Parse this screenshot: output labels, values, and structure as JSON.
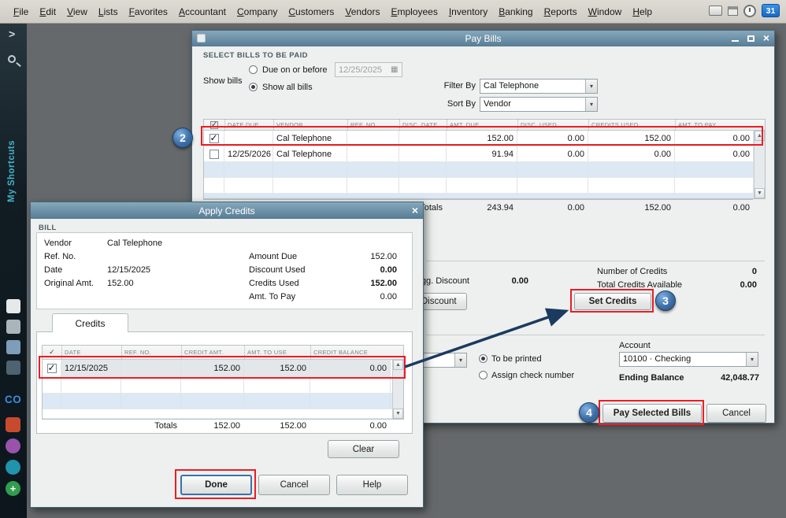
{
  "menu": {
    "items": [
      "File",
      "Edit",
      "View",
      "Lists",
      "Favorites",
      "Accountant",
      "Company",
      "Customers",
      "Vendors",
      "Employees",
      "Inventory",
      "Banking",
      "Reports",
      "Window",
      "Help"
    ],
    "reminder_badge": "31"
  },
  "sidebar": {
    "my_shortcuts": "My Shortcuts",
    "co": "CO"
  },
  "pay_bills": {
    "title": "Pay Bills",
    "select_section": "SELECT BILLS TO BE PAID",
    "show_bills": "Show bills",
    "due_on_or_before": "Due on or before",
    "due_date": "12/25/2025",
    "show_all_bills": "Show all bills",
    "filter_by": "Filter By",
    "filter_value": "Cal Telephone",
    "sort_by": "Sort By",
    "sort_value": "Vendor",
    "columns": {
      "date_due": "DATE DUE",
      "vendor": "VENDOR",
      "ref_no": "REF. NO.",
      "disc_date": "DISC. DATE",
      "amt_due": "AMT. DUE",
      "disc_used": "DISC. USED",
      "credits_used": "CREDITS USED",
      "amt_to_pay": "AMT. TO PAY"
    },
    "rows": [
      {
        "date_due": "",
        "vendor": "Cal Telephone",
        "amt_due": "152.00",
        "disc_used": "0.00",
        "credits_used": "152.00",
        "amt_to_pay": "0.00"
      },
      {
        "date_due": "12/25/2026",
        "vendor": "Cal Telephone",
        "amt_due": "91.94",
        "disc_used": "0.00",
        "credits_used": "0.00",
        "amt_to_pay": "0.00"
      }
    ],
    "totals_label": "Totals",
    "totals": {
      "amt_due": "243.94",
      "disc_used": "0.00",
      "credits_used": "152.00",
      "amt_to_pay": "0.00"
    },
    "sugg_discount_label": "Sugg. Discount",
    "sugg_discount_value": "0.00",
    "set_discount_btn": "Set Discount",
    "set_credits_btn": "Set Credits",
    "number_of_credits_label": "Number of Credits",
    "number_of_credits_value": "0",
    "total_credits_label": "Total Credits Available",
    "total_credits_value": "0.00",
    "to_be_printed": "To be printed",
    "assign_check_number": "Assign check number",
    "account_label": "Account",
    "account_value": "10100 · Checking",
    "ending_balance_label": "Ending Balance",
    "ending_balance_value": "42,048.77",
    "pay_selected_btn": "Pay Selected Bills",
    "cancel_btn": "Cancel"
  },
  "apply_credits": {
    "title": "Apply Credits",
    "bill_section": "BILL",
    "vendor_label": "Vendor",
    "vendor_value": "Cal Telephone",
    "ref_no_label": "Ref. No.",
    "date_label": "Date",
    "date_value": "12/15/2025",
    "original_amt_label": "Original Amt.",
    "original_amt_value": "152.00",
    "amount_due_label": "Amount Due",
    "amount_due_value": "152.00",
    "discount_used_label": "Discount Used",
    "discount_used_value": "0.00",
    "credits_used_label": "Credits Used",
    "credits_used_value": "152.00",
    "amt_to_pay_label": "Amt. To Pay",
    "amt_to_pay_value": "0.00",
    "credits_tab": "Credits",
    "columns": {
      "date": "DATE",
      "ref_no": "REF. NO.",
      "credit_amt": "CREDIT AMT.",
      "amt_to_use": "AMT. TO USE",
      "credit_balance": "CREDIT BALANCE"
    },
    "rows": [
      {
        "date": "12/15/2025",
        "credit_amt": "152.00",
        "amt_to_use": "152.00",
        "credit_balance": "0.00"
      }
    ],
    "totals_label": "Totals",
    "totals": {
      "credit_amt": "152.00",
      "amt_to_use": "152.00",
      "credit_balance": "0.00"
    },
    "clear_btn": "Clear",
    "done_btn": "Done",
    "cancel_btn": "Cancel",
    "help_btn": "Help"
  },
  "annotations": {
    "step2": "2",
    "step3": "3",
    "step4": "4"
  },
  "colors": {
    "annotation_red": "#ee1c25",
    "callout_blue": "#3c6ea6",
    "arrow_navy": "#1b3a5f",
    "titlebar_blue": "#577c94"
  }
}
